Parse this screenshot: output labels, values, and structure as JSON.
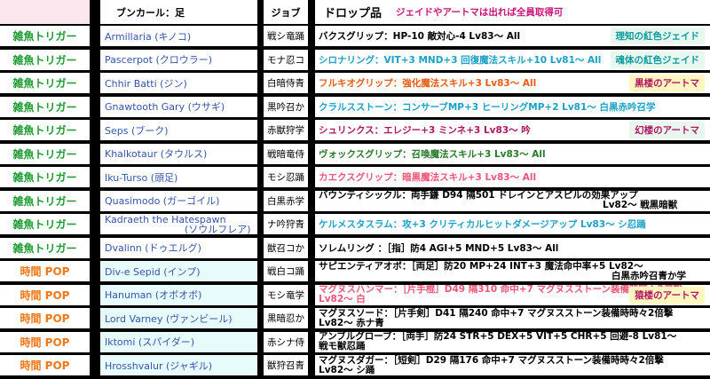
{
  "header": {
    "col_mob": "ブンカール：足",
    "col_job": "ジョブ",
    "col_drop": "ドロップ品",
    "note": "ジェイドやアートマは出れば全員取得可"
  },
  "rows": [
    {
      "type": "雑魚トリガー",
      "mob": "Armillaria (キノコ)",
      "job": "戦シ竜踊",
      "drop": "バクスグリップ：HP-10 敵対心-4 Lv83～ All",
      "drop_color": "#000000",
      "badge": "理知の紅色ジェイド",
      "badge_style": "green"
    },
    {
      "type": "雑魚トリガー",
      "mob": "Pascerpot (クロウラー)",
      "job": "モナ忍コ",
      "drop": "シロナリング：VIT+3 MND+3 回復魔法スキル+10 Lv81～ All",
      "drop_color": "#1aa1c8",
      "badge": "魂体の紅色ジェイド",
      "badge_style": "green"
    },
    {
      "type": "雑魚トリガー",
      "mob": "Chhir Batti (ジン)",
      "job": "白暗侍青",
      "drop": "フルキオグリップ：強化魔法スキル+3 Lv83～ All",
      "drop_color": "#e85a10",
      "badge": "黒楼のアートマ",
      "badge_style": "yellow"
    },
    {
      "type": "雑魚トリガー",
      "mob": "Gnawtooth Gary (ウサギ)",
      "job": "黒吟召か",
      "drop": "クラルスストーン：コンサーブMP+3 ヒーリングMP+2 Lv81～ 白黒赤吟召学",
      "drop_color": "#1aa1c8",
      "badge": "",
      "badge_style": ""
    },
    {
      "type": "雑魚トリガー",
      "mob": "Seps (ブーク)",
      "job": "赤獣狩学",
      "drop": "シュリンクス：エレジー+3 ミンネ+3 Lv83～ 吟",
      "drop_color": "#b01460",
      "badge": "幻楼のアートマ",
      "badge_style": "pink"
    },
    {
      "type": "雑魚トリガー",
      "mob": "Khalkotaur (タウルス)",
      "job": "戦暗竜侍",
      "drop": "ヴォックスグリップ：召喚魔法スキル+3 Lv83～ All",
      "drop_color": "#2a7a2a",
      "badge": "",
      "badge_style": ""
    },
    {
      "type": "雑魚トリガー",
      "mob": "Iku-Turso (頭足)",
      "job": "モシ忍踊",
      "drop": "カエクスグリップ：暗黒魔法スキル+3 Lv83～ All",
      "drop_color": "#ee5577",
      "badge": "",
      "badge_style": ""
    },
    {
      "type": "雑魚トリガー",
      "mob": "Quasimodo (ガーゴイル)",
      "job": "白黒赤学",
      "drop": "バウンティシックル：両手鎌 D94 隔501 ドレインとアスピルの効果アップ",
      "drop2": "Lv82～ 戦黒暗獣",
      "drop_color": "#000000",
      "badge": "",
      "badge_style": ""
    },
    {
      "type": "雑魚トリガー",
      "mob": "Kadraeth the Hatespawn",
      "mob2": "(ソウルフレア)",
      "job": "ナ吟狩青",
      "drop": "ケルメスタスラム：攻+3 クリティカルヒットダメージアップ Lv83～ シ忍踊",
      "drop_color": "#1aa1c8",
      "badge": "",
      "badge_style": ""
    },
    {
      "type": "雑魚トリガー",
      "mob": "Dvalinn (ドゥエルグ)",
      "job": "獣召コか",
      "drop": "ソレムリング ：［指］防4 AGI+5 MND+5 Lv83～ All",
      "drop_color": "#000000",
      "badge": "",
      "badge_style": ""
    },
    {
      "type": "時間 POP",
      "mob": "Div-e Sepid (インプ)",
      "job": "戦白コ踊",
      "drop": "サピエンティアオボ：［両足］防20 MP+24 INT+3 魔法命中率+5 Lv82～",
      "drop2": "白黒赤吟召青か学",
      "drop_color": "#000000",
      "badge": "",
      "badge_style": ""
    },
    {
      "type": "時間 POP",
      "mob": "Hanuman (オボオボ)",
      "job": "モシ竜学",
      "drop": "マグヌスハンマー：［片手棍］D49 隔310 命中+7 マグヌスストーン装備時時々2倍撃",
      "drop2": "Lv82～ 白",
      "drop_color": "#ee5577",
      "badge": "猿楼のアートマ",
      "badge_style": "yellow"
    },
    {
      "type": "時間 POP",
      "mob": "Lord Varney (ヴァンビール)",
      "job": "黒暗忍か",
      "drop": "マグヌスソード：［片手剣］D41 隔240 命中+7 マグヌスストーン装備時時々2倍撃",
      "drop2": "Lv82～ 赤ナ青",
      "drop_color": "#000000",
      "badge": "",
      "badge_style": ""
    },
    {
      "type": "時間 POP",
      "mob": "Iktomi (スパイダー)",
      "job": "赤シナ侍",
      "drop": "アンブルグローブ：［両手］防24 STR+5 DEX+5 VIT+5 CHR+5 回避-8 Lv81～",
      "drop2": "戦モ獣忍踊",
      "drop_color": "#000000",
      "badge": "",
      "badge_style": ""
    },
    {
      "type": "時間 POP",
      "mob": "Hrosshvalur (ジャギル)",
      "job": "獣狩召青",
      "drop": "マグヌスダガー：［短剣］D29 隔176 命中+7 マグヌスストーン装備時時々2倍撃",
      "drop2": "Lv82～ シ踊",
      "drop_color": "#000000",
      "badge": "",
      "badge_style": ""
    }
  ],
  "colors": {
    "trigger": "#1a9a2e",
    "pop": "#f07818",
    "header_note": "#c81478",
    "link": "#3355aa"
  }
}
